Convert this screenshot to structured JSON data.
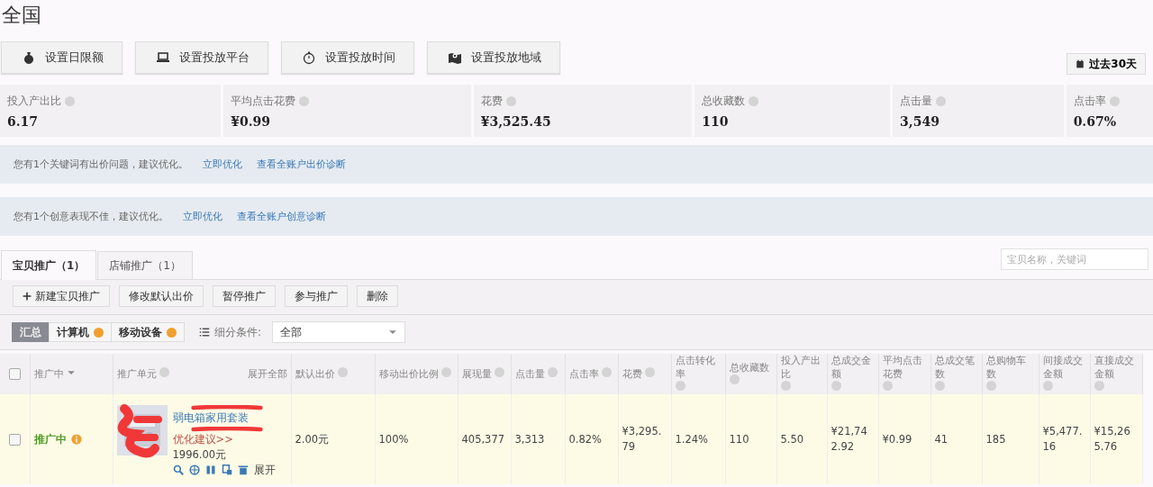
{
  "page_title": "全国",
  "setting_buttons": [
    {
      "kind": "bag",
      "label": "设置日限额"
    },
    {
      "kind": "laptop",
      "label": "设置投放平台"
    },
    {
      "kind": "timer",
      "label": "设置投放时间"
    },
    {
      "kind": "map",
      "label": "设置投放地域"
    }
  ],
  "date_range": "过去30天",
  "summary": [
    {
      "label": "投入产出比",
      "value": "6.17"
    },
    {
      "label": "平均点击花费",
      "value": "¥0.99"
    },
    {
      "label": "花费",
      "value": "¥3,525.45"
    },
    {
      "label": "总收藏数",
      "value": "110"
    },
    {
      "label": "点击量",
      "value": "3,549"
    },
    {
      "label": "点击率",
      "value": "0.67%"
    }
  ],
  "notices": [
    {
      "text": "您有1个关键词有出价问题，建议优化。",
      "action": "立即优化",
      "link": "查看全账户出价诊断"
    },
    {
      "text": "您有1个创意表现不佳，建议优化。",
      "action": "立即优化",
      "link": "查看全账户创意诊断"
    }
  ],
  "tabs": [
    {
      "label": "宝贝推广（1）",
      "selected": true
    },
    {
      "label": "店铺推广（1）",
      "selected": false
    }
  ],
  "search": {
    "placeholder": "宝贝名称，关键词"
  },
  "actions": [
    {
      "label": "新建宝贝推广",
      "plus": true
    },
    {
      "label": "修改默认出价",
      "plus": false
    },
    {
      "label": "暂停推广",
      "plus": false
    },
    {
      "label": "参与推广",
      "plus": false
    },
    {
      "label": "删除",
      "plus": false
    }
  ],
  "segments": [
    {
      "label": "汇总",
      "selected": true,
      "badge": false
    },
    {
      "label": "计算机",
      "selected": false,
      "badge": true
    },
    {
      "label": "移动设备",
      "selected": false,
      "badge": true
    }
  ],
  "breakdown": {
    "label": "细分条件:",
    "value": "全部"
  },
  "table": {
    "all_checked": false,
    "columns": [
      {
        "label": "推广中",
        "kind": "filter"
      },
      {
        "label": "推广单元",
        "kind": "unit",
        "expand_all": "展开全部"
      },
      {
        "label": "默认出价",
        "kind": "help"
      },
      {
        "label": "移动出价比例",
        "kind": "help"
      },
      {
        "label": "展现量",
        "kind": "help"
      },
      {
        "label": "点击量",
        "kind": "help"
      },
      {
        "label": "点击率",
        "kind": "help"
      },
      {
        "label": "花费",
        "kind": "help"
      },
      {
        "label": "点击转化率",
        "kind": "help"
      },
      {
        "label": "总收藏数",
        "kind": "help"
      },
      {
        "label": "投入产出比",
        "kind": "help"
      },
      {
        "label": "总成交金额",
        "kind": "help"
      },
      {
        "label": "平均点击花费",
        "kind": "help"
      },
      {
        "label": "总成交笔数",
        "kind": "help"
      },
      {
        "label": "总购物车数",
        "kind": "help"
      },
      {
        "label": "间接成交金额",
        "kind": "help"
      },
      {
        "label": "直接成交金额",
        "kind": "help"
      }
    ],
    "rows": [
      {
        "checked": false,
        "status": "推广中",
        "title": "弱电箱家用套装",
        "suggestion": "优化建议>>",
        "budget": "1996.00元",
        "expand": "展开",
        "values": [
          "2.00元",
          "100%",
          "405,377",
          "3,313",
          "0.82%",
          "¥3,295.79",
          "1.24%",
          "110",
          "5.50",
          "¥21,742.92",
          "¥0.99",
          "41",
          "185",
          "¥5,477.16",
          "¥15,265.76"
        ]
      }
    ]
  }
}
